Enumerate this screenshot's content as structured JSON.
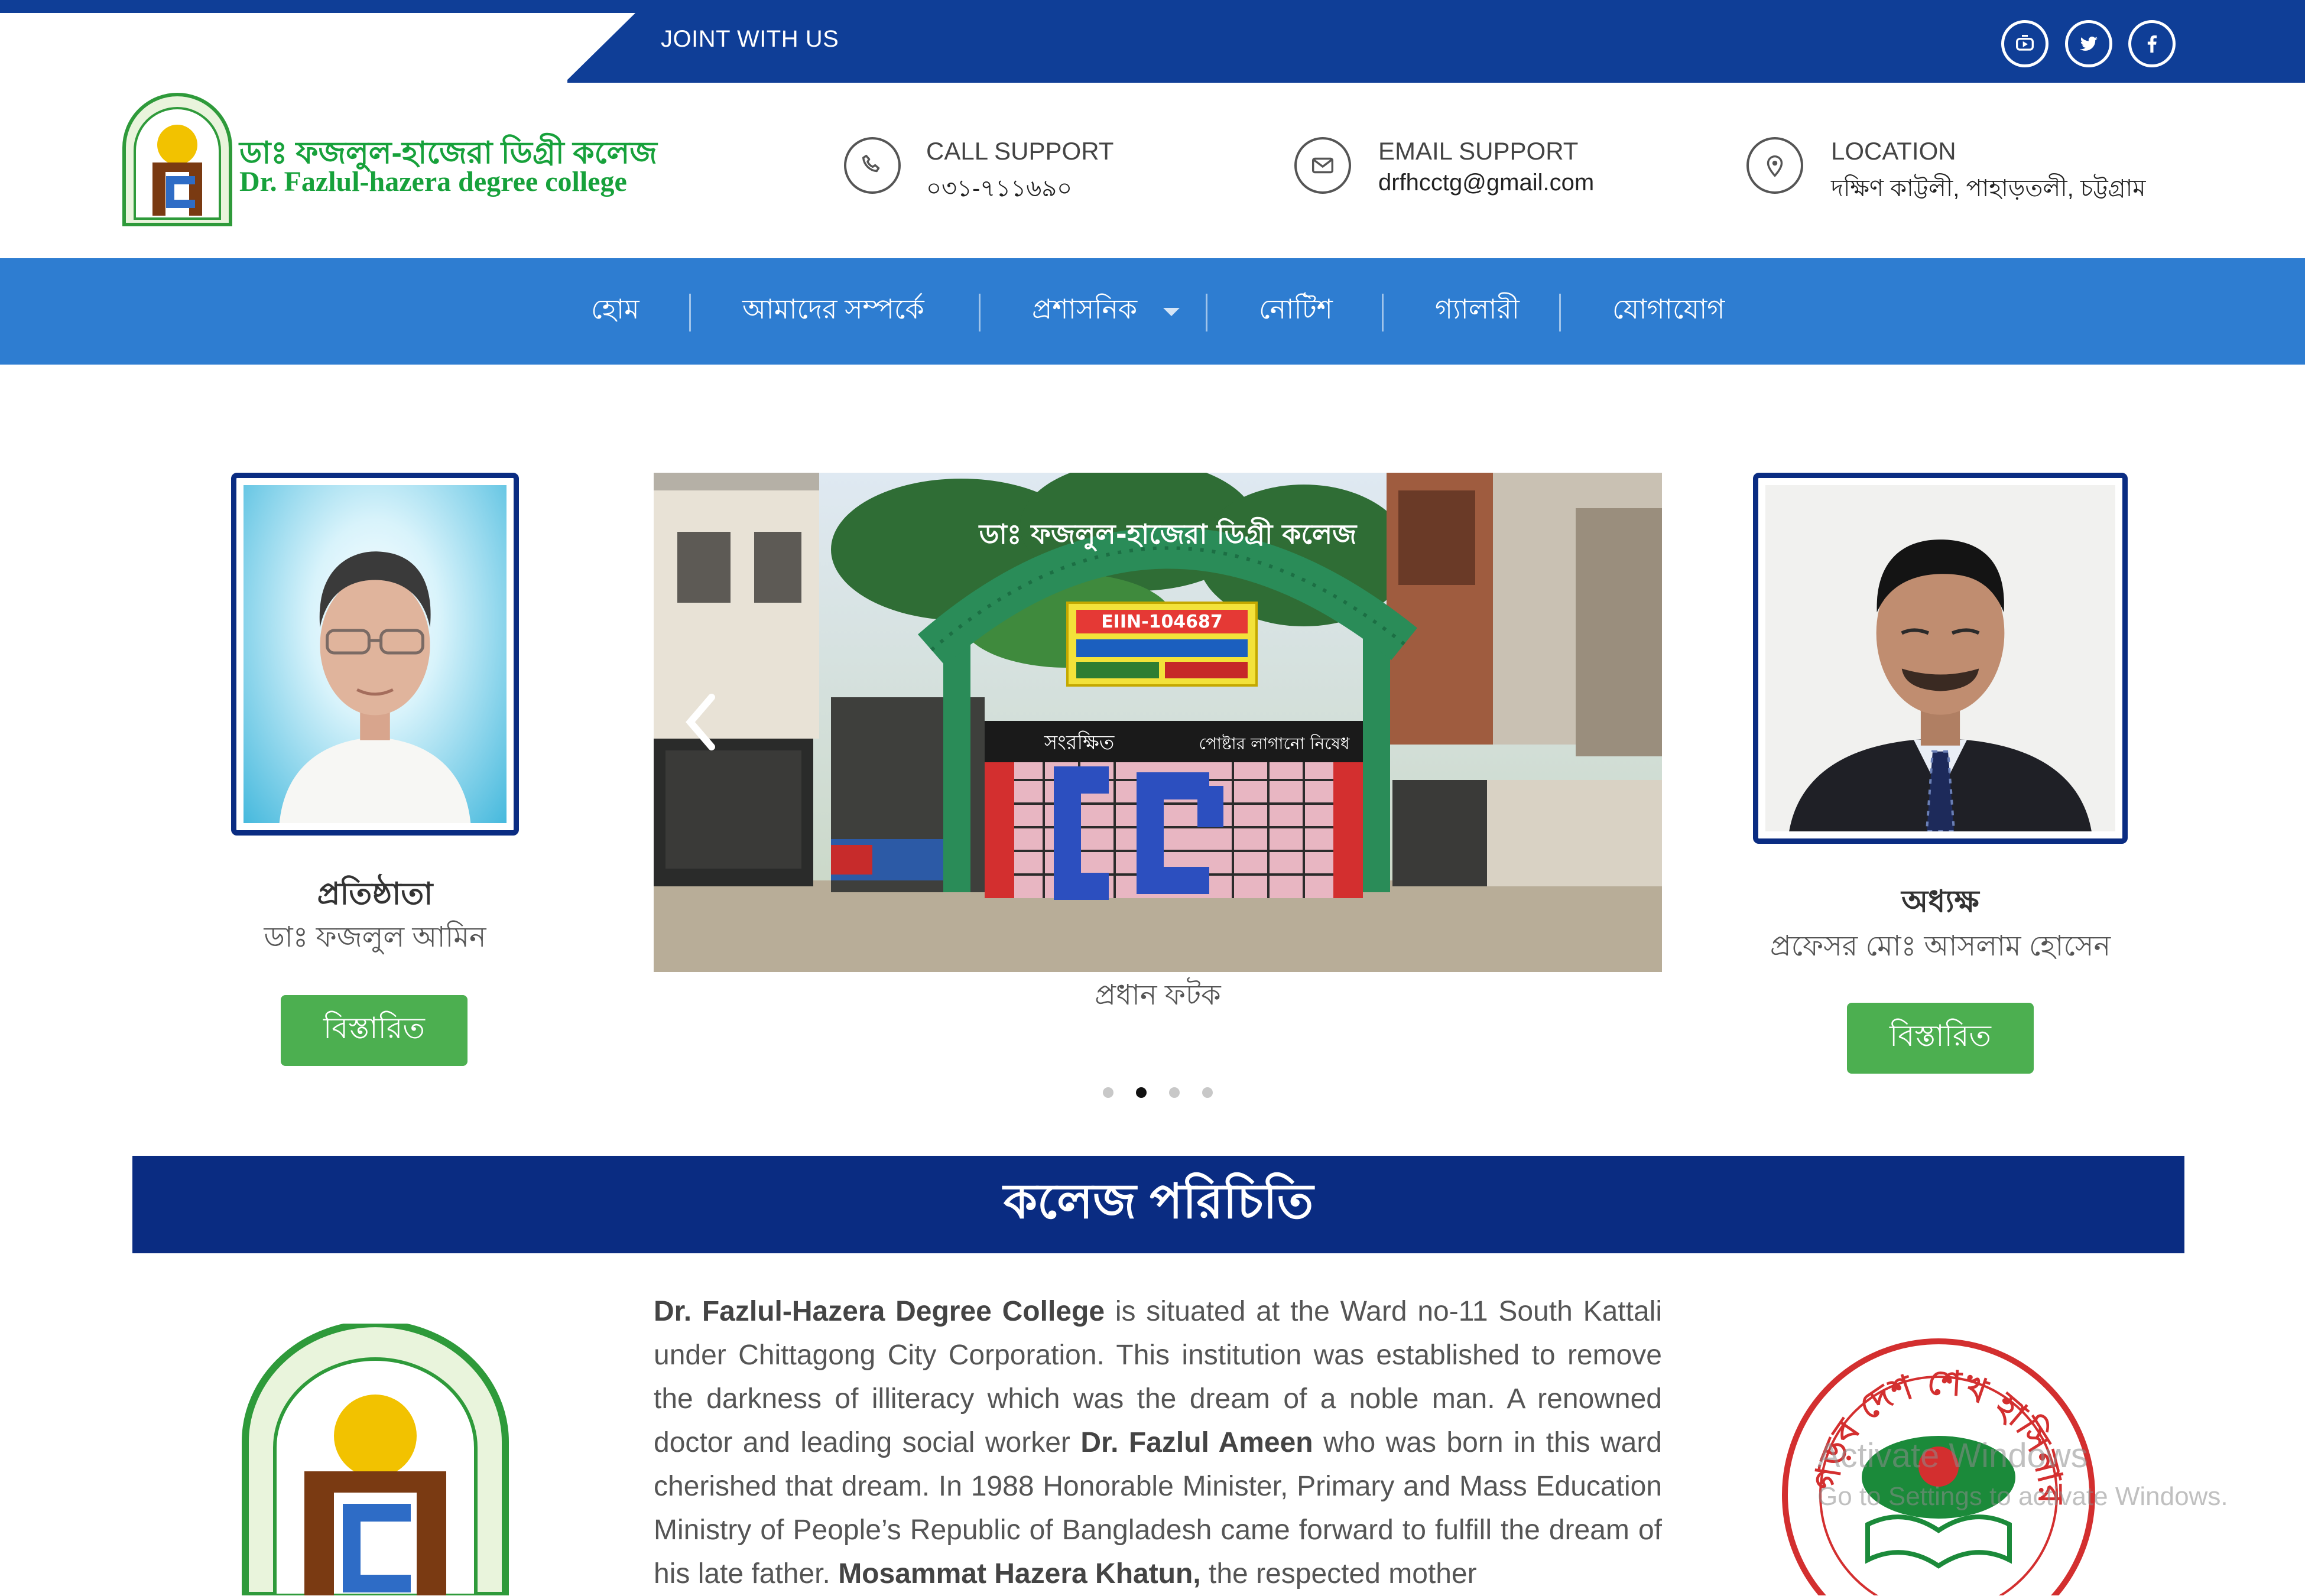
{
  "topbar": {
    "join_label": "JOINT WITH US",
    "social": [
      "youtube-icon",
      "twitter-icon",
      "facebook-icon"
    ]
  },
  "header": {
    "college_name_bn": "ডাঃ ফজলুল-হাজেরা ডিগ্রী কলেজ",
    "college_name_en": "Dr. Fazlul-hazera degree college",
    "contacts": [
      {
        "icon": "phone-icon",
        "title": "CALL SUPPORT",
        "value": "০৩১-৭১১৬৯০"
      },
      {
        "icon": "email-icon",
        "title": "EMAIL SUPPORT",
        "value": "drfhcctg@gmail.com"
      },
      {
        "icon": "location-icon",
        "title": "LOCATION",
        "value": "দক্ষিণ কাট্টলী, পাহাড়তলী, চট্টগ্রাম"
      }
    ]
  },
  "nav": {
    "items": [
      "হোম",
      "আমাদের সম্পর্কে",
      "প্রশাসনিক",
      "নোটিশ",
      "গ্যালারী",
      "যোগাযোগ"
    ]
  },
  "founder": {
    "role": "প্রতিষ্ঠাতা",
    "name": "ডাঃ ফজলুল আমিন",
    "button": "বিস্তারিত"
  },
  "principal": {
    "role": "অধ্যক্ষ",
    "name": "প্রফেসর মোঃ আসলাম হোসেন",
    "button": "বিস্তারিত"
  },
  "slider": {
    "caption": "প্রধান ফটক",
    "active_slide": 2,
    "slide_count": 4,
    "sign_main": "ডাঃ ফজলুল-হাজেরা ডিগ্রী কলেজ",
    "sign_eiin": "EIIN-104687",
    "sign_left": "সংরক্ষিত",
    "sign_right": "পোষ্টার লাগানো নিষেধ"
  },
  "intro": {
    "heading": "কলেজ পরিচিতি",
    "p_bold1": "Dr. Fazlul-Hazera Degree College",
    "p1": " is situated at the Ward no-11 South Kattali under Chittagong City Corporation. This institution was established to remove the darkness of illiteracy which was the dream of a noble man. A renowned doctor and leading social worker ",
    "p_bold2": "Dr. Fazlul Ameen",
    "p2": " who was born in this ward cherished that dream. In 1988 Honorable Minister, Primary and Mass Education Ministry of People’s Republic of Bangladesh came forward to fulfill the dream of his late father. ",
    "p_bold3": "Mosammat Hazera Khatun,",
    "p3": " the respected mother"
  },
  "emblem": {
    "text": "শিক্ষা নিয়ে গড়ব দেশ শেখ হাসিনার বাংলাদেশ"
  },
  "watermark": {
    "line1": "Activate Windows",
    "line2": "Go to Settings to activate Windows."
  }
}
